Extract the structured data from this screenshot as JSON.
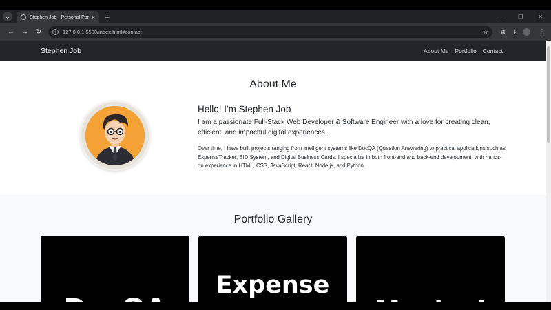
{
  "browser": {
    "tab_title": "Stephen Job - Personal Portfolio",
    "url": "127.0.0.1:5500/index.html#contact"
  },
  "nav": {
    "brand": "Stephen Job",
    "links": [
      "About Me",
      "Portfolio",
      "Contact"
    ]
  },
  "about": {
    "title": "About Me",
    "greeting": "Hello! I'm Stephen Job",
    "lead": "I am a passionate Full-Stack Web Developer & Software Engineer with a love for creating clean, efficient, and impactful digital experiences.",
    "detail": "Over time, I have built projects ranging from intelligent systems like DocQA (Question Answering) to practical applications such as ExpenseTracker, BID System, and Digital Business Cards. I specialize in both front-end and back-end development, with hands-on experience in HTML, CSS, JavaScript, React, Node.js, and Python."
  },
  "portfolio": {
    "title": "Portfolio Gallery",
    "cards": [
      {
        "text": "DocQA"
      },
      {
        "text": "Expense"
      },
      {
        "text": "Manipal"
      }
    ]
  },
  "colors": {
    "navbar": "#212529",
    "avatar_bg": "#f4a235",
    "card_bg": "#000000"
  }
}
